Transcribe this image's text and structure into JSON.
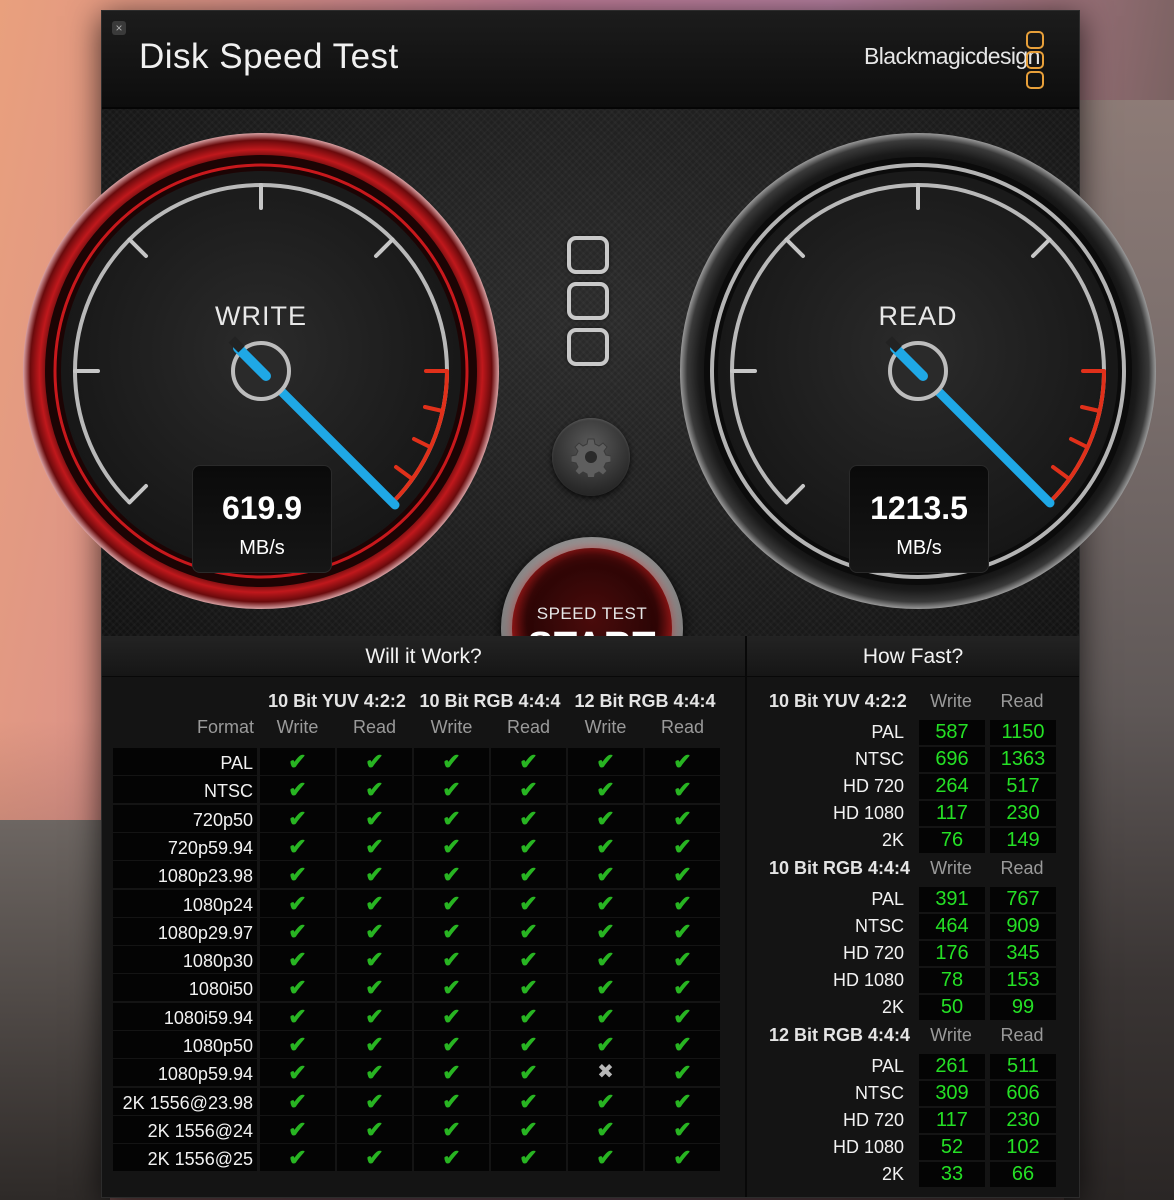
{
  "window": {
    "title": "Disk Speed Test",
    "brand": "Blackmagicdesign"
  },
  "gauges": {
    "write": {
      "label": "WRITE",
      "value": "619.9",
      "unit": "MB/s"
    },
    "read": {
      "label": "READ",
      "value": "1213.5",
      "unit": "MB/s"
    }
  },
  "start_button": {
    "top_label": "SPEED TEST",
    "label": "START"
  },
  "will_it_work": {
    "title": "Will it Work?",
    "format_header": "Format",
    "groups": [
      "10 Bit YUV 4:2:2",
      "10 Bit RGB 4:4:4",
      "12 Bit RGB 4:4:4"
    ],
    "sub_headers": [
      "Write",
      "Read",
      "Write",
      "Read",
      "Write",
      "Read"
    ],
    "rows": [
      {
        "format": "PAL",
        "results": [
          "ok",
          "ok",
          "ok",
          "ok",
          "ok",
          "ok"
        ]
      },
      {
        "format": "NTSC",
        "results": [
          "ok",
          "ok",
          "ok",
          "ok",
          "ok",
          "ok"
        ]
      },
      {
        "format": "720p50",
        "results": [
          "ok",
          "ok",
          "ok",
          "ok",
          "ok",
          "ok"
        ]
      },
      {
        "format": "720p59.94",
        "results": [
          "ok",
          "ok",
          "ok",
          "ok",
          "ok",
          "ok"
        ]
      },
      {
        "format": "1080p23.98",
        "results": [
          "ok",
          "ok",
          "ok",
          "ok",
          "ok",
          "ok"
        ]
      },
      {
        "format": "1080p24",
        "results": [
          "ok",
          "ok",
          "ok",
          "ok",
          "ok",
          "ok"
        ]
      },
      {
        "format": "1080p29.97",
        "results": [
          "ok",
          "ok",
          "ok",
          "ok",
          "ok",
          "ok"
        ]
      },
      {
        "format": "1080p30",
        "results": [
          "ok",
          "ok",
          "ok",
          "ok",
          "ok",
          "ok"
        ]
      },
      {
        "format": "1080i50",
        "results": [
          "ok",
          "ok",
          "ok",
          "ok",
          "ok",
          "ok"
        ]
      },
      {
        "format": "1080i59.94",
        "results": [
          "ok",
          "ok",
          "ok",
          "ok",
          "ok",
          "ok"
        ]
      },
      {
        "format": "1080p50",
        "results": [
          "ok",
          "ok",
          "ok",
          "ok",
          "ok",
          "ok"
        ]
      },
      {
        "format": "1080p59.94",
        "results": [
          "ok",
          "ok",
          "ok",
          "ok",
          "fail",
          "ok"
        ]
      },
      {
        "format": "2K 1556@23.98",
        "results": [
          "ok",
          "ok",
          "ok",
          "ok",
          "ok",
          "ok"
        ]
      },
      {
        "format": "2K 1556@24",
        "results": [
          "ok",
          "ok",
          "ok",
          "ok",
          "ok",
          "ok"
        ]
      },
      {
        "format": "2K 1556@25",
        "results": [
          "ok",
          "ok",
          "ok",
          "ok",
          "ok",
          "ok"
        ]
      }
    ]
  },
  "how_fast": {
    "title": "How Fast?",
    "sections": [
      {
        "title": "10 Bit YUV 4:2:2",
        "write_header": "Write",
        "read_header": "Read",
        "rows": [
          {
            "format": "PAL",
            "write": "587",
            "read": "1150"
          },
          {
            "format": "NTSC",
            "write": "696",
            "read": "1363"
          },
          {
            "format": "HD 720",
            "write": "264",
            "read": "517"
          },
          {
            "format": "HD 1080",
            "write": "117",
            "read": "230"
          },
          {
            "format": "2K",
            "write": "76",
            "read": "149"
          }
        ]
      },
      {
        "title": "10 Bit RGB 4:4:4",
        "write_header": "Write",
        "read_header": "Read",
        "rows": [
          {
            "format": "PAL",
            "write": "391",
            "read": "767"
          },
          {
            "format": "NTSC",
            "write": "464",
            "read": "909"
          },
          {
            "format": "HD 720",
            "write": "176",
            "read": "345"
          },
          {
            "format": "HD 1080",
            "write": "78",
            "read": "153"
          },
          {
            "format": "2K",
            "write": "50",
            "read": "99"
          }
        ]
      },
      {
        "title": "12 Bit RGB 4:4:4",
        "write_header": "Write",
        "read_header": "Read",
        "rows": [
          {
            "format": "PAL",
            "write": "261",
            "read": "511"
          },
          {
            "format": "NTSC",
            "write": "309",
            "read": "606"
          },
          {
            "format": "HD 720",
            "write": "117",
            "read": "230"
          },
          {
            "format": "HD 1080",
            "write": "52",
            "read": "102"
          },
          {
            "format": "2K",
            "write": "33",
            "read": "66"
          }
        ]
      }
    ]
  },
  "colors": {
    "check": "#28b522",
    "fast_value": "#25e025",
    "write_ring": "#c0181c",
    "needle": "#1fa8e6",
    "brand_logo": "#e8a03a"
  }
}
